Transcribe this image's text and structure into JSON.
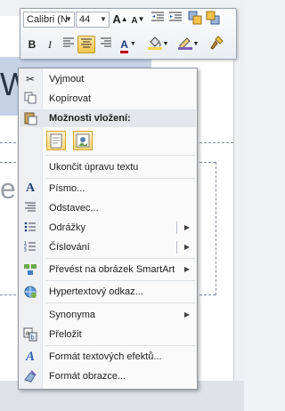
{
  "background": {
    "title_char": "W",
    "body_char": "e"
  },
  "mini_toolbar": {
    "font_name": "Calibri (N",
    "font_size": "44",
    "grow_font": "A",
    "shrink_font": "A",
    "bold": "B",
    "italic": "I",
    "font_color_letter": "A"
  },
  "context_menu": {
    "items": [
      {
        "label": "Vyjmout",
        "icon": "scissors-icon"
      },
      {
        "label": "Kopírovat",
        "icon": "copy-icon"
      },
      {
        "label": "Možnosti vložení:",
        "icon": "paste-icon"
      },
      {
        "label": "Ukončit úpravu textu",
        "icon": ""
      },
      {
        "label": "Písmo...",
        "icon": "font-icon"
      },
      {
        "label": "Odstavec...",
        "icon": "paragraph-icon"
      },
      {
        "label": "Odrážky",
        "icon": "bullets-icon"
      },
      {
        "label": "Číslování",
        "icon": "numbering-icon"
      },
      {
        "label": "Převést na obrázek SmartArt",
        "icon": "smartart-icon"
      },
      {
        "label": "Hypertextový odkaz...",
        "icon": "hyperlink-icon"
      },
      {
        "label": "Synonyma",
        "icon": ""
      },
      {
        "label": "Přeložit",
        "icon": "translate-icon"
      },
      {
        "label": "Formát textových efektů...",
        "icon": "text-effects-icon"
      },
      {
        "label": "Formát obrazce...",
        "icon": "shape-format-icon"
      }
    ]
  },
  "colors": {
    "font_color": "#c00000",
    "highlight_active": "#f8c64c",
    "menu_border": "#8e96a3"
  }
}
